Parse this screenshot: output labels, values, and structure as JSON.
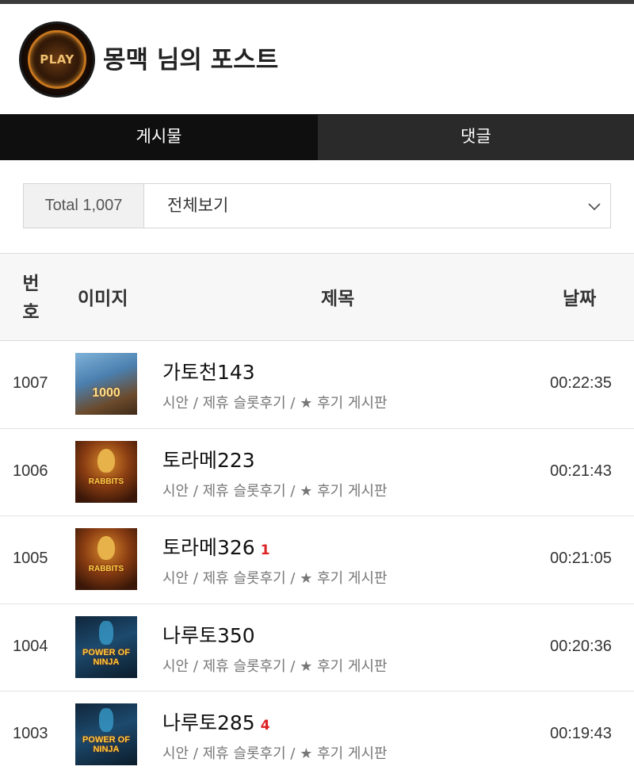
{
  "profile": {
    "title": "몽맥 님의 포스트",
    "avatar_text": "PLAY",
    "avatar_icon": "play-logo-avatar"
  },
  "tabs": [
    {
      "label": "게시물",
      "active": true
    },
    {
      "label": "댓글",
      "active": false
    }
  ],
  "filter": {
    "total_label": "Total 1,007",
    "selected": "전체보기",
    "dropdown_icon": "chevron-down-icon"
  },
  "table": {
    "headers": {
      "num": "번호",
      "image": "이미지",
      "title": "제목",
      "date": "날짜"
    },
    "rows": [
      {
        "num": "1007",
        "title": "가토천143",
        "comments": "",
        "category": "시안 / 제휴 슬롯후기 / ★ 후기 게시판",
        "date": "00:22:35",
        "thumb": "gates",
        "thumb_text": "1000"
      },
      {
        "num": "1006",
        "title": "토라메223",
        "comments": "",
        "category": "시안 / 제휴 슬롯후기 / ★ 후기 게시판",
        "date": "00:21:43",
        "thumb": "rabbits",
        "thumb_text": "RABBITS"
      },
      {
        "num": "1005",
        "title": "토라메326",
        "comments": "1",
        "category": "시안 / 제휴 슬롯후기 / ★ 후기 게시판",
        "date": "00:21:05",
        "thumb": "rabbits",
        "thumb_text": "RABBITS"
      },
      {
        "num": "1004",
        "title": "나루토350",
        "comments": "",
        "category": "시안 / 제휴 슬롯후기 / ★ 후기 게시판",
        "date": "00:20:36",
        "thumb": "power",
        "thumb_text": "POWER OF NINJA"
      },
      {
        "num": "1003",
        "title": "나루토285",
        "comments": "4",
        "category": "시안 / 제휴 슬롯후기 / ★ 후기 게시판",
        "date": "00:19:43",
        "thumb": "power",
        "thumb_text": "POWER OF NINJA"
      }
    ]
  },
  "colors": {
    "tab_active_bg": "#0f0f0f",
    "tab_inactive_bg": "#2a2a2a",
    "comment_count": "#dd2222"
  }
}
